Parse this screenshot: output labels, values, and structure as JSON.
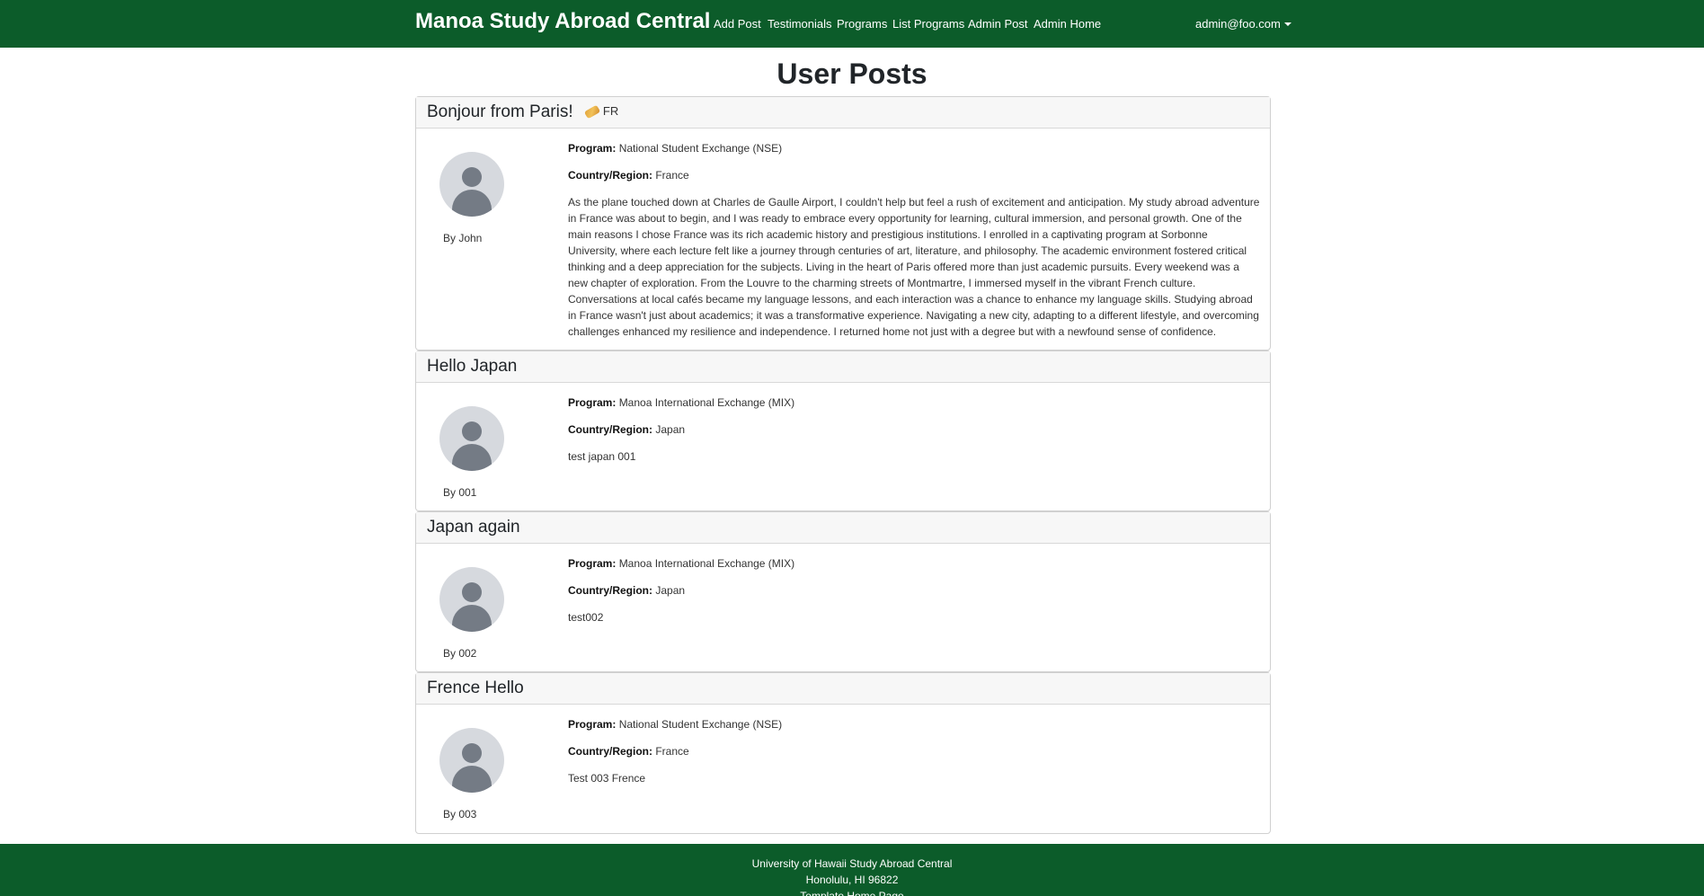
{
  "navbar": {
    "brand": "Manoa Study Abroad Central",
    "links": [
      "Add Post",
      "Testimonials",
      "Programs",
      "List Programs",
      "Admin Post",
      "Admin Home"
    ],
    "user": "admin@foo.com"
  },
  "page_title": "User Posts",
  "labels": {
    "program": "Program:",
    "country": "Country/Region:"
  },
  "posts": [
    {
      "title": "Bonjour from Paris!",
      "flag_icon": "bandage-icon",
      "flag_code": "FR",
      "author": "By John",
      "program": "National Student Exchange (NSE)",
      "country": "France",
      "content": "As the plane touched down at Charles de Gaulle Airport, I couldn't help but feel a rush of excitement and anticipation. My study abroad adventure in France was about to begin, and I was ready to embrace every opportunity for learning, cultural immersion, and personal growth. One of the main reasons I chose France was its rich academic history and prestigious institutions. I enrolled in a captivating program at Sorbonne University, where each lecture felt like a journey through centuries of art, literature, and philosophy. The academic environment fostered critical thinking and a deep appreciation for the subjects. Living in the heart of Paris offered more than just academic pursuits. Every weekend was a new chapter of exploration. From the Louvre to the charming streets of Montmartre, I immersed myself in the vibrant French culture. Conversations at local cafés became my language lessons, and each interaction was a chance to enhance my language skills. Studying abroad in France wasn't just about academics; it was a transformative experience. Navigating a new city, adapting to a different lifestyle, and overcoming challenges enhanced my resilience and independence. I returned home not just with a degree but with a newfound sense of confidence."
    },
    {
      "title": "Hello Japan",
      "author": "By 001",
      "program": "Manoa International Exchange (MIX)",
      "country": "Japan",
      "content": "test japan 001"
    },
    {
      "title": "Japan again",
      "author": "By 002",
      "program": "Manoa International Exchange (MIX)",
      "country": "Japan",
      "content": "test002"
    },
    {
      "title": "Frence Hello",
      "author": "By 003",
      "program": "National Student Exchange (NSE)",
      "country": "France",
      "content": "Test 003 Frence"
    }
  ],
  "footer": {
    "line1": "University of Hawaii Study Abroad Central",
    "line2": "Honolulu, HI 96822",
    "line3": "Template Home Page"
  },
  "colors": {
    "primary": "#0c5c2a",
    "card_header_bg": "#f7f7f7",
    "avatar_bg": "#d6d9de",
    "avatar_fg": "#747b85"
  }
}
